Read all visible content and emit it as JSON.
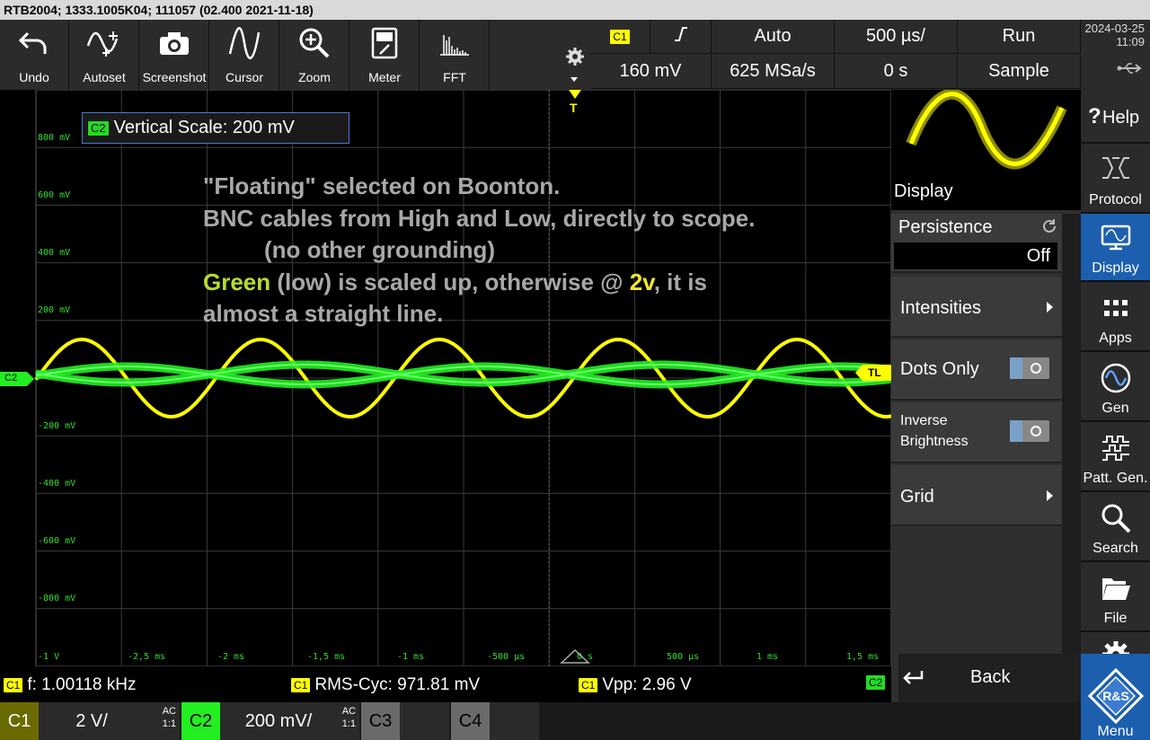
{
  "titlebar": {
    "text": "RTB2004; 1333.1005K04; 111057 (02.400 2021-11-18)"
  },
  "toolbar": {
    "tools": [
      {
        "label": "Undo",
        "icon": "undo-icon"
      },
      {
        "label": "Autoset",
        "icon": "autoset-icon"
      },
      {
        "label": "Screenshot",
        "icon": "camera-icon"
      },
      {
        "label": "Cursor",
        "icon": "cursor-icon"
      },
      {
        "label": "Zoom",
        "icon": "zoom-icon"
      },
      {
        "label": "Meter",
        "icon": "meter-icon"
      },
      {
        "label": "FFT",
        "icon": "fft-icon"
      }
    ]
  },
  "status": {
    "trigger_source": "C1",
    "trigger_level": "160 mV",
    "trigger_mode": "Auto",
    "sample_rate": "625 MSa/s",
    "timebase": "500 µs/",
    "time_offset": "0 s",
    "run_state": "Run",
    "acq_mode": "Sample"
  },
  "clock": {
    "date": "2024-03-25",
    "time": "11:09"
  },
  "plot": {
    "scale_box": {
      "channel": "C2",
      "text": "Vertical Scale: 200 mV"
    },
    "note": {
      "line1": "\"Floating\" selected on Boonton.",
      "line2": "BNC cables from High and Low, directly to scope.",
      "line3": "(no other grounding)",
      "line4_green": "Green",
      "line4_mid": " (low) is scaled up, otherwise @ ",
      "line4_yellow": "2v",
      "line4_end": ", it is",
      "line5": "almost a straight line."
    },
    "y_labels": [
      "800 mV",
      "600 mV",
      "400 mV",
      "200 mV",
      "-200 mV",
      "-400 mV",
      "-600 mV",
      "-800 mV",
      "-1 V"
    ],
    "x_labels": [
      "-2,5 ms",
      "-2 ms",
      "-1,5 ms",
      "-1 ms",
      "-500 µs",
      "0 s",
      "500 µs",
      "1 ms",
      "1,5 ms"
    ],
    "c2_marker": "C2",
    "tl_marker": "TL",
    "trigger_marker": "T",
    "colors": {
      "c1": "#ffff00",
      "c2": "#22ee22",
      "grid": "#3c3c3c",
      "label": "#33dd33"
    }
  },
  "measurements": [
    {
      "channel": "C1",
      "text": "f: 1.00118 kHz"
    },
    {
      "channel": "C1",
      "text": "RMS-Cyc: 971.81 mV"
    },
    {
      "channel": "C1",
      "text": "Vpp: 2.96 V"
    }
  ],
  "meas_right_badge": "C2",
  "channels": [
    {
      "name": "C1",
      "value": "2 V/",
      "coupling": "AC",
      "ratio": "1:1"
    },
    {
      "name": "C2",
      "value": "200 mV/",
      "coupling": "AC",
      "ratio": "1:1"
    },
    {
      "name": "C3"
    },
    {
      "name": "C4"
    }
  ],
  "side_menu": {
    "thumb_label": "Display",
    "persistence": {
      "label": "Persistence",
      "value": "Off"
    },
    "intensities": "Intensities",
    "dots_only": "Dots Only",
    "inverse_line1": "Inverse",
    "inverse_line2": "Brightness",
    "grid": "Grid",
    "back": "Back"
  },
  "right_nav": {
    "help": "Help",
    "items": [
      {
        "label": "Protocol",
        "icon": "protocol-icon"
      },
      {
        "label": "Display",
        "icon": "display-icon"
      },
      {
        "label": "Apps",
        "icon": "apps-icon"
      },
      {
        "label": "Gen",
        "icon": "generator-icon"
      },
      {
        "label": "Patt. Gen.",
        "icon": "pattern-generator-icon"
      },
      {
        "label": "Search",
        "icon": "search-icon"
      },
      {
        "label": "File",
        "icon": "folder-icon"
      }
    ],
    "menu": "Menu"
  }
}
